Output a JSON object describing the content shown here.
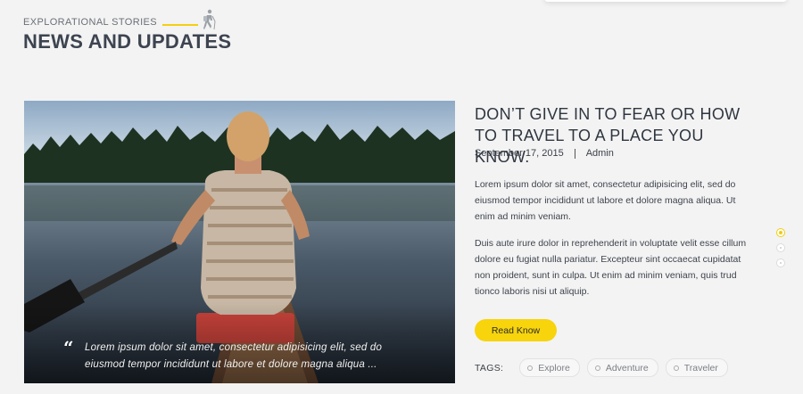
{
  "section": {
    "eyebrow": "EXPLORATIONAL STORIES",
    "title": "NEWS AND UPDATES"
  },
  "photo": {
    "quote": "Lorem ipsum dolor sit amet, consectetur adipisicing elit, sed do eiusmod tempor incididunt ut labore et dolore magna aliqua ..."
  },
  "post": {
    "title": "DON’T GIVE IN TO FEAR OR HOW TO TRAVEL TO A PLACE YOU KNOW.",
    "date": "September 17, 2015",
    "author": "Admin",
    "paragraphs": [
      "Lorem ipsum dolor sit amet, consectetur adipisicing elit, sed do eiusmod tempor incididunt ut labore et dolore magna aliqua. Ut enim ad minim veniam.",
      "Duis aute irure dolor in reprehenderit in voluptate velit esse cillum dolore eu fugiat nulla pariatur. Excepteur sint occaecat cupidatat non proident, sunt in culpa. Ut enim ad minim veniam, quis trud tionco laboris nisi ut aliquip."
    ],
    "button_label": "Read Know",
    "tags_label": "TAGS:",
    "tags": [
      "Explore",
      "Adventure",
      "Traveler"
    ]
  },
  "carousel": {
    "active_index": 0,
    "count": 3
  },
  "colors": {
    "accent": "#f7d40c",
    "background": "#f3f3f3"
  }
}
